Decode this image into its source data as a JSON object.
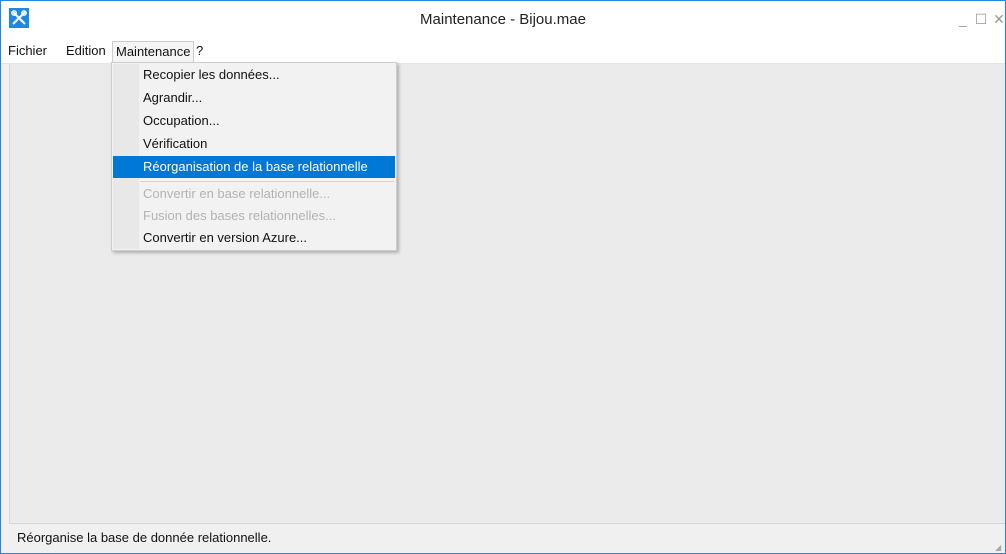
{
  "window": {
    "title": "Maintenance - Bijou.mae",
    "icon": "tools-icon",
    "accent_color": "#1e88e5",
    "controls": {
      "minimize": "_",
      "maximize": "☐",
      "close": "✕"
    }
  },
  "menubar": {
    "items": [
      {
        "label": "Fichier"
      },
      {
        "label": "Edition"
      },
      {
        "label": "Maintenance"
      },
      {
        "label": "?"
      }
    ]
  },
  "dropdown": {
    "items": [
      {
        "label": "Recopier les données...",
        "state": "enabled"
      },
      {
        "label": "Agrandir...",
        "state": "enabled"
      },
      {
        "label": "Occupation...",
        "state": "enabled"
      },
      {
        "label": "Vérification",
        "state": "enabled"
      },
      {
        "label": "Réorganisation de la base relationnelle",
        "state": "selected"
      },
      {
        "label": "Convertir en base relationnelle...",
        "state": "disabled"
      },
      {
        "label": "Fusion des bases relationnelles...",
        "state": "disabled"
      },
      {
        "label": "Convertir en version Azure...",
        "state": "enabled"
      }
    ],
    "selected_color": "#0078d7"
  },
  "statusbar": {
    "text": "Réorganise la base de donnée relationnelle."
  }
}
